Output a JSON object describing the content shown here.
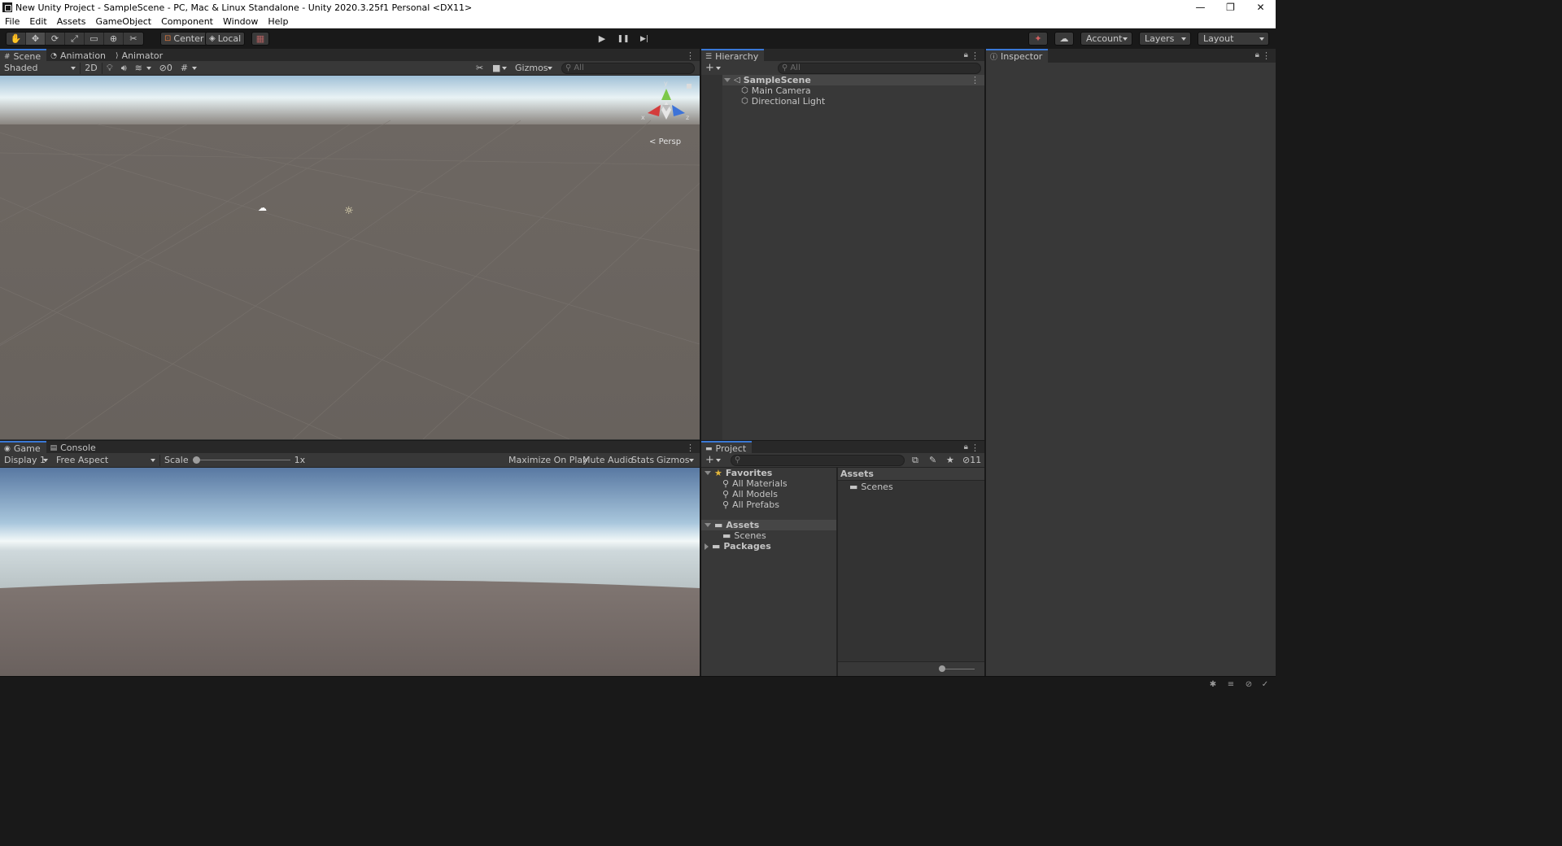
{
  "window": {
    "title": "New Unity Project - SampleScene - PC, Mac & Linux Standalone - Unity 2020.3.25f1 Personal <DX11>",
    "minimize": "—",
    "restore": "❐",
    "close": "✕"
  },
  "menu": [
    "File",
    "Edit",
    "Assets",
    "GameObject",
    "Component",
    "Window",
    "Help"
  ],
  "toolbar": {
    "tools": [
      {
        "name": "hand-tool",
        "icon": "✋"
      },
      {
        "name": "move-tool",
        "icon": "✥"
      },
      {
        "name": "rotate-tool",
        "icon": "⟳"
      },
      {
        "name": "scale-tool",
        "icon": "⤢"
      },
      {
        "name": "rect-tool",
        "icon": "▭"
      },
      {
        "name": "transform-tool",
        "icon": "⊕"
      },
      {
        "name": "custom-tool",
        "icon": "✂"
      }
    ],
    "pivot_label": "Center",
    "space_label": "Local",
    "snap_icon": "▦",
    "play_icon": "▶",
    "pause_icon": "❚❚",
    "step_icon": "▶|",
    "collab_icon": "✦",
    "cloud_icon": "☁",
    "account_label": "Account",
    "layers_label": "Layers",
    "layout_label": "Layout"
  },
  "scene_panel": {
    "tabs": [
      {
        "label": "Scene",
        "icon": "#"
      },
      {
        "label": "Animation",
        "icon": "◔"
      },
      {
        "label": "Animator",
        "icon": "⟩"
      }
    ],
    "shading_mode": "Shaded",
    "mode_2d": "2D",
    "hidden_count": "0",
    "gizmos_label": "Gizmos",
    "search_placeholder": "All",
    "persp_label": "Persp",
    "axis_x": "x",
    "axis_y": "y",
    "axis_z": "z"
  },
  "game_panel": {
    "tabs": [
      {
        "label": "Game",
        "icon": "◉"
      },
      {
        "label": "Console",
        "icon": "▤"
      }
    ],
    "display": "Display 1",
    "aspect": "Free Aspect",
    "scale_label": "Scale",
    "scale_value": 0,
    "scale_value_label": "1x",
    "maximize_on_play": "Maximize On Play",
    "mute_audio": "Mute Audio",
    "stats": "Stats",
    "gizmos_label": "Gizmos"
  },
  "hierarchy_panel": {
    "tab": "Hierarchy",
    "add_label": "+",
    "search_placeholder": "All",
    "scene_name": "SampleScene",
    "items": [
      "Main Camera",
      "Directional Light"
    ]
  },
  "inspector_panel": {
    "tab": "Inspector"
  },
  "project_panel": {
    "tab": "Project",
    "add_label": "+",
    "hidden_packages_count": "11",
    "favorites": {
      "label": "Favorites",
      "items": [
        "All Materials",
        "All Models",
        "All Prefabs"
      ]
    },
    "tree": {
      "assets_label": "Assets",
      "assets_children": [
        "Scenes"
      ],
      "packages_label": "Packages"
    },
    "content_header": "Assets",
    "content_items": [
      "Scenes"
    ],
    "icon_size_value": 0
  },
  "colors": {
    "accent": "#3a78d6",
    "background": "#383838",
    "dark_background": "#191919"
  }
}
